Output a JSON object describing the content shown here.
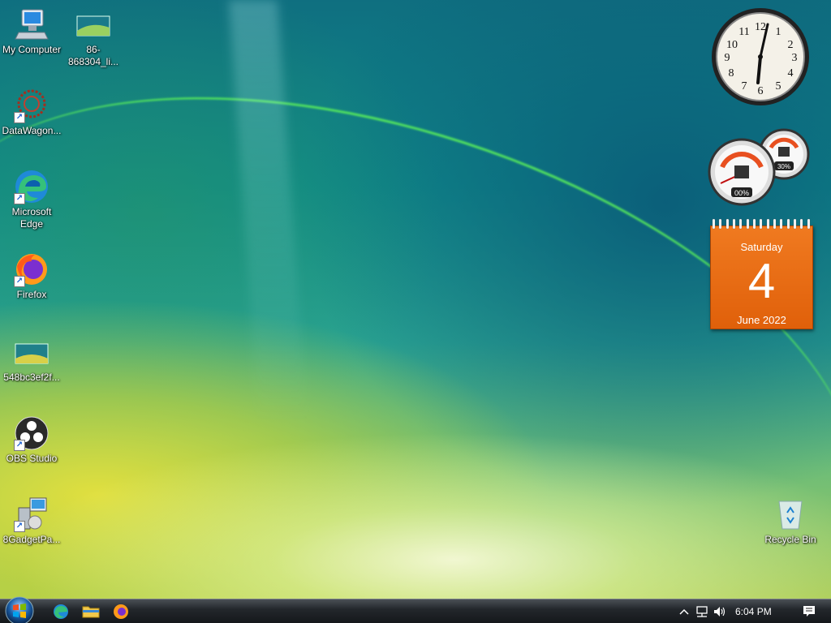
{
  "desktop_icons": [
    {
      "label": "My Computer",
      "icon": "computer-icon"
    },
    {
      "label": "86-868304_li...",
      "icon": "image-file-icon"
    },
    {
      "label": "DataWagon...",
      "icon": "datawagon-icon"
    },
    {
      "label": "Microsoft Edge",
      "icon": "edge-icon"
    },
    {
      "label": "Firefox",
      "icon": "firefox-icon"
    },
    {
      "label": "548bc3ef2f...",
      "icon": "image-file-icon"
    },
    {
      "label": "OBS Studio",
      "icon": "obs-icon"
    },
    {
      "label": "8GadgetPa...",
      "icon": "installer-icon"
    },
    {
      "label": "Recycle Bin",
      "icon": "recycle-bin-icon"
    }
  ],
  "gadgets": {
    "clock": {
      "numerals": [
        "12",
        "1",
        "2",
        "3",
        "4",
        "5",
        "6",
        "7",
        "8",
        "9",
        "10",
        "11"
      ],
      "time": "6:04"
    },
    "cpu_meter": {
      "cpu_label": "00%",
      "memory_label": "30%"
    },
    "calendar": {
      "weekday": "Saturday",
      "day": "4",
      "month_year": "June 2022"
    }
  },
  "taskbar": {
    "pinned": [
      "edge-icon",
      "file-explorer-icon",
      "firefox-icon"
    ],
    "tray": {
      "time": "6:04 PM"
    }
  }
}
